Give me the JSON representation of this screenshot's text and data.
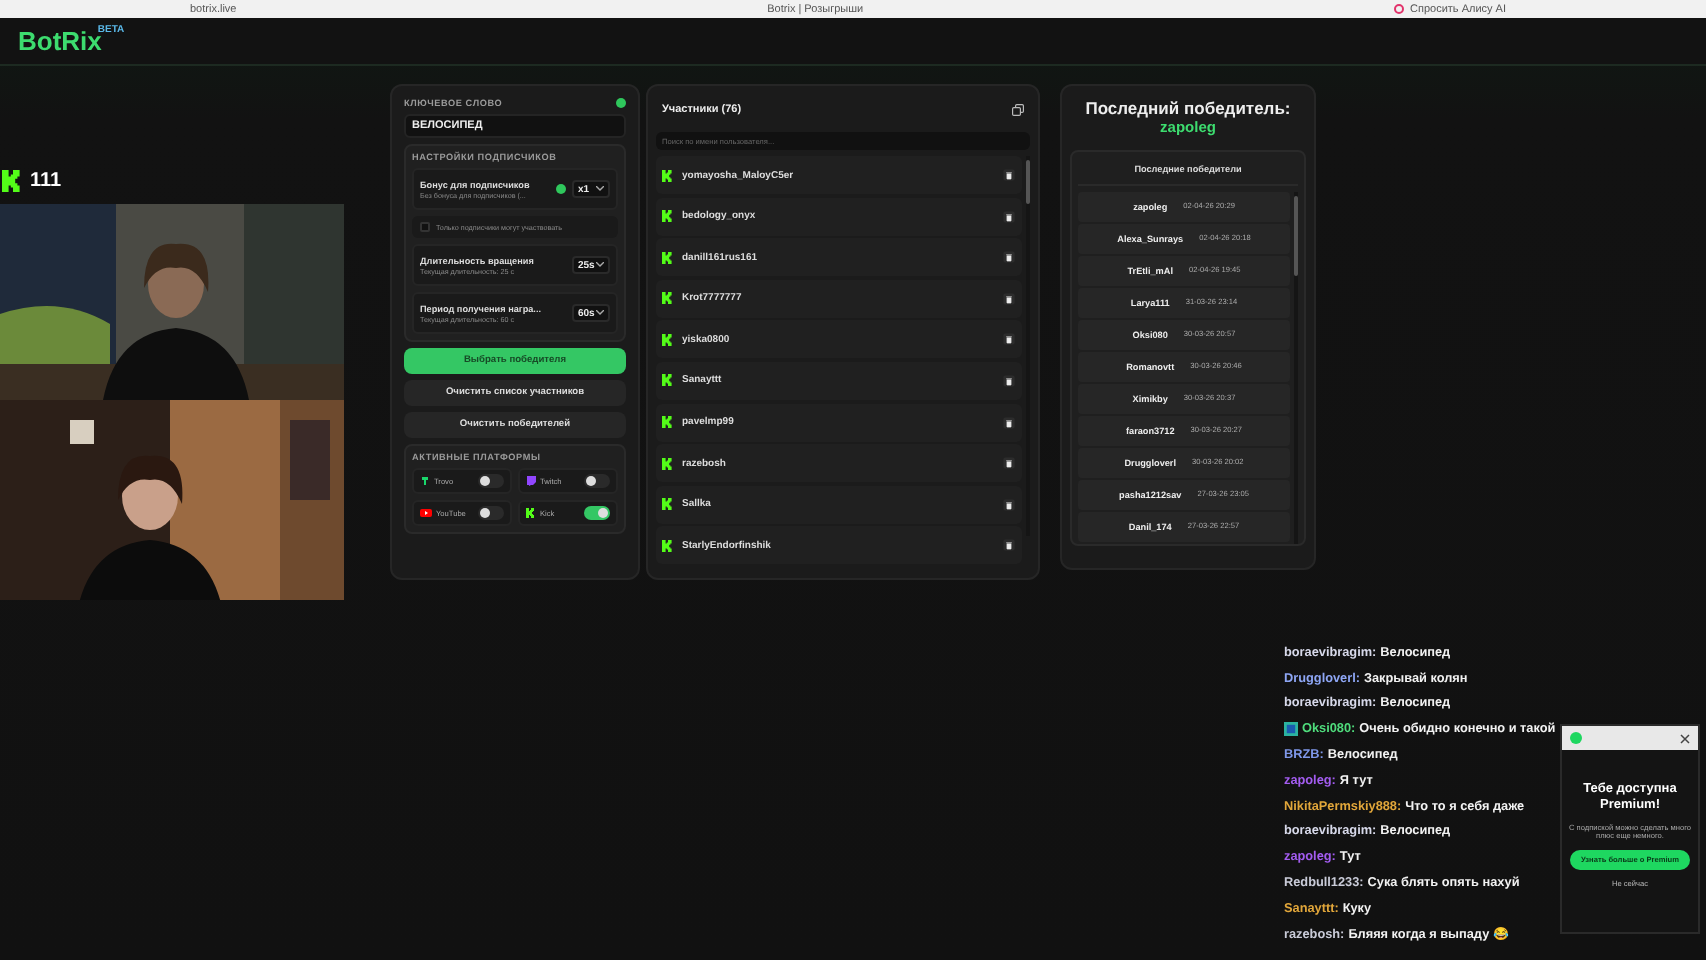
{
  "browser": {
    "address": "botrix.live",
    "title": "Botrix | Розыгрыши",
    "assistant": "Спросить Алису AI"
  },
  "header": {
    "logo": "BotRix",
    "badge": "BETA"
  },
  "settings": {
    "keyword_label": "КЛЮЧЕВОЕ СЛОВО",
    "keyword": "ВЕЛОСИПЕД",
    "subs_title": "НАСТРОЙКИ ПОДПИСЧИКОВ",
    "rows": [
      {
        "kind": "select",
        "title": "Бонус для подписчиков",
        "hint": "Без бонуса для подписчиков (...",
        "value": "x1",
        "info": true
      },
      {
        "kind": "checkbox",
        "title": "Только подписчики могут участвовать",
        "checked": false
      },
      {
        "kind": "select",
        "title": "Длительность вращения",
        "hint": "Текущая длительность: 25 с",
        "value": "25s",
        "info": false
      },
      {
        "kind": "select",
        "title": "Период получения награ...",
        "hint": "Текущая длительность: 60 с",
        "value": "60s",
        "info": false
      }
    ],
    "buttons": [
      {
        "label": "Выбрать победителя",
        "primary": true
      },
      {
        "label": "Очистить список участников",
        "primary": false
      },
      {
        "label": "Очистить победителей",
        "primary": false
      }
    ],
    "platforms_title": "АКТИВНЫЕ ПЛАТФОРМЫ",
    "platforms": [
      {
        "kind": "trovo",
        "name": "Trovo",
        "on": false
      },
      {
        "kind": "twitch",
        "name": "Twitch",
        "on": false
      },
      {
        "kind": "youtube",
        "name": "YouTube",
        "on": false
      },
      {
        "kind": "kick",
        "name": "Kick",
        "on": true
      }
    ]
  },
  "participants": {
    "title": "Участники (76)",
    "search_placeholder": "Поиск по имени пользователя...",
    "users": [
      "yomayosha_MaloyC5er",
      "bedology_onyx",
      "danill161rus161",
      "Krot7777777",
      "yiska0800",
      "Sanayttt",
      "pavelmp99",
      "razebosh",
      "Sallka",
      "StarlyEndorfinshik"
    ]
  },
  "winners": {
    "title": "Последний победитель:",
    "last": "zapoleg",
    "table_title": "Последние победители",
    "rows": [
      {
        "name": "zapoleg",
        "date": "02-04-26 20:29"
      },
      {
        "name": "Alexa_Sunrays",
        "date": "02-04-26 20:18"
      },
      {
        "name": "TrEtli_mAl",
        "date": "02-04-26 19:45"
      },
      {
        "name": "Larya111",
        "date": "31-03-26 23:14"
      },
      {
        "name": "Oksi080",
        "date": "30-03-26 20:57"
      },
      {
        "name": "Romanovtt",
        "date": "30-03-26 20:46"
      },
      {
        "name": "Ximikby",
        "date": "30-03-26 20:37"
      },
      {
        "name": "faraon3712",
        "date": "30-03-26 20:27"
      },
      {
        "name": "Druggloverl",
        "date": "30-03-26 20:02"
      },
      {
        "name": "pasha1212sav",
        "date": "27-03-26 23:05"
      },
      {
        "name": "Danil_174",
        "date": "27-03-26 22:57"
      }
    ]
  },
  "overlay": {
    "kick_count": "111",
    "chat": [
      {
        "user": "boraevibragim:",
        "color": "#d7d9ea",
        "text": "Велосипед"
      },
      {
        "user": "Druggloverl:",
        "color": "#8ea6f5",
        "text": "Закрывай колян"
      },
      {
        "user": "boraevibragim:",
        "color": "#d7d9ea",
        "text": "Велосипед"
      },
      {
        "user": "Oksi080:",
        "color": "#4fdc7c",
        "text": "Очень обидно конечно и такой",
        "badge": true
      },
      {
        "user": "BRZB:",
        "color": "#7f98ea",
        "text": "Велосипед"
      },
      {
        "user": "zapoleg:",
        "color": "#a35cf0",
        "text": "Я тут"
      },
      {
        "user": "NikitaPermskiy888:",
        "color": "#e1a63a",
        "text": "Что то я себя даже"
      },
      {
        "user": "boraevibragim:",
        "color": "#d7d9ea",
        "text": "Велосипед"
      },
      {
        "user": "zapoleg:",
        "color": "#a35cf0",
        "text": "Тут"
      },
      {
        "user": "Redbull1233:",
        "color": "#c9cbd8",
        "text": "Сука блять опять нахуй"
      },
      {
        "user": "Sanayttt:",
        "color": "#e1a63a",
        "text": "Куку"
      },
      {
        "user": "razebosh:",
        "color": "#c9cbd8",
        "text": "Бляяя когда я выпаду 😂"
      }
    ],
    "popup": {
      "title": "Тебе доступна Premium!",
      "body": "С подпиской можно сделать много плюс еще немного.",
      "button": "Узнать больше о Premium",
      "dismiss": "Не сейчас"
    }
  }
}
